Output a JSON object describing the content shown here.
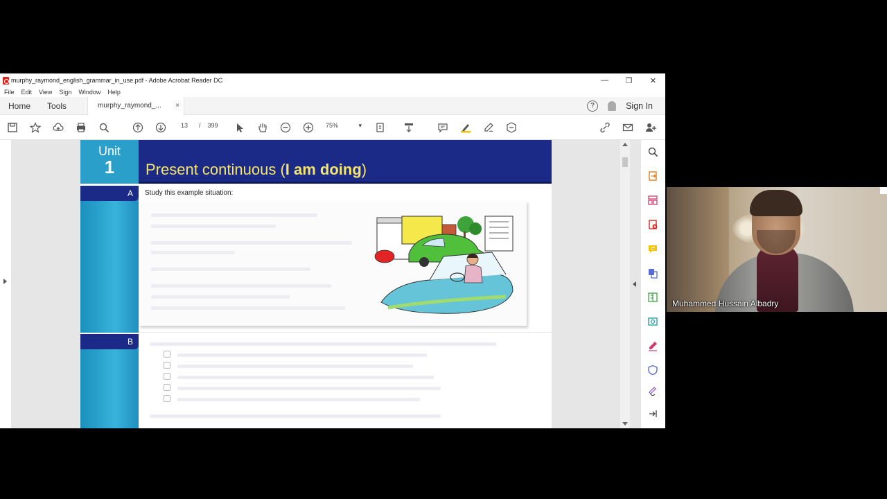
{
  "window": {
    "title": "murphy_raymond_english_grammar_in_use.pdf - Adobe Acrobat Reader DC",
    "minimize": "—",
    "restore": "❐",
    "close": "✕"
  },
  "menu": [
    "File",
    "Edit",
    "View",
    "Sign",
    "Window",
    "Help"
  ],
  "tabs": {
    "home": "Home",
    "tools": "Tools",
    "document": "murphy_raymond_...",
    "document_close": "×",
    "help": "?",
    "sign_in": "Sign In"
  },
  "toolbar": {
    "current_page": "13",
    "page_separator": "/",
    "total_pages": "399",
    "zoom": "75%",
    "zoom_caret": "▾"
  },
  "page": {
    "unit_word": "Unit",
    "unit_number": "1",
    "title_plain": "Present continuous (",
    "title_bold": "I am doing",
    "title_end": ")",
    "section_a": "A",
    "section_b": "B",
    "study_text": "Study this example situation:"
  },
  "webcam": {
    "participant_name": "Muhammed Hussain Albadry"
  },
  "colors": {
    "unit_bar": "#1b2a86",
    "unit_box": "#2a9fc9",
    "title_yellow": "#f5e56a",
    "highlight_yellow": "#f2c500",
    "pdf_red": "#d9261c"
  }
}
